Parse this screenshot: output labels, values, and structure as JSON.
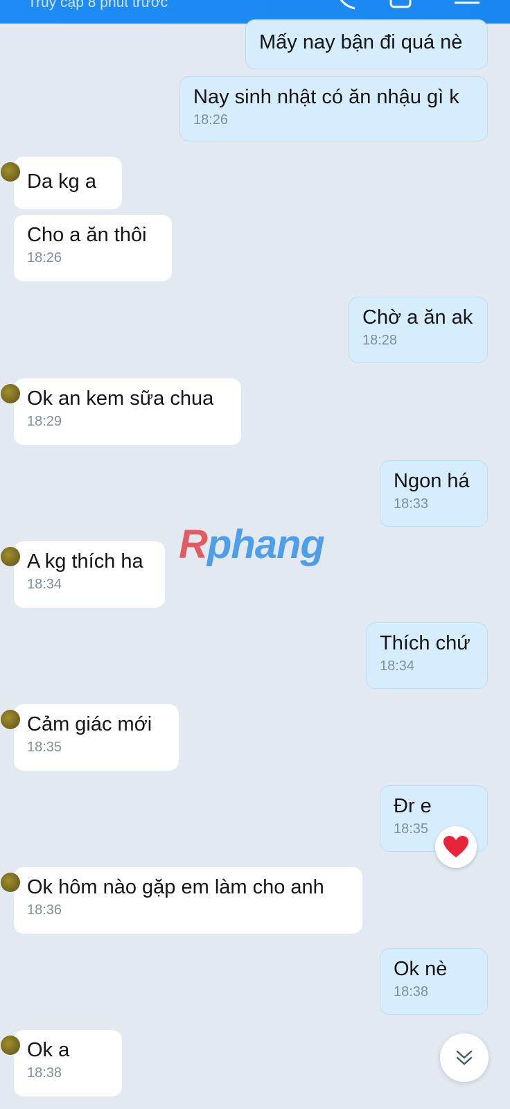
{
  "header": {
    "status": "Truy cập 8 phút trước"
  },
  "messages": [
    {
      "text": "Mấy nay bận đi quá nè",
      "time": ""
    },
    {
      "text": "Nay sinh nhật có ăn nhậu gì k",
      "time": "18:26"
    },
    {
      "text": "Da kg a",
      "time": ""
    },
    {
      "text": "Cho a ăn thôi",
      "time": "18:26"
    },
    {
      "text": "Chờ a ăn ak",
      "time": "18:28"
    },
    {
      "text": "Ok an kem sữa chua",
      "time": "18:29"
    },
    {
      "text": "Ngon há",
      "time": "18:33"
    },
    {
      "text": "A kg thích ha",
      "time": "18:34"
    },
    {
      "text": "Thích chứ",
      "time": "18:34"
    },
    {
      "text": "Cảm giác mới",
      "time": "18:35"
    },
    {
      "text": "Đr e",
      "time": "18:35"
    },
    {
      "text": "Ok hôm nào gặp em làm cho anh",
      "time": "18:36"
    },
    {
      "text": "Ok nè",
      "time": "18:38"
    },
    {
      "text": "Ok a",
      "time": "18:38"
    }
  ],
  "watermark": {
    "part1": "R",
    "part2": "phang"
  },
  "reaction": {
    "icon": "heart-icon",
    "color": "#e8243a"
  },
  "scroll_button": {
    "icon": "double-chevron-down-icon"
  },
  "colors": {
    "header": "#1a87f0",
    "incoming": "#ffffff",
    "outgoing": "#d6edfd",
    "background": "#e2e9f1"
  }
}
